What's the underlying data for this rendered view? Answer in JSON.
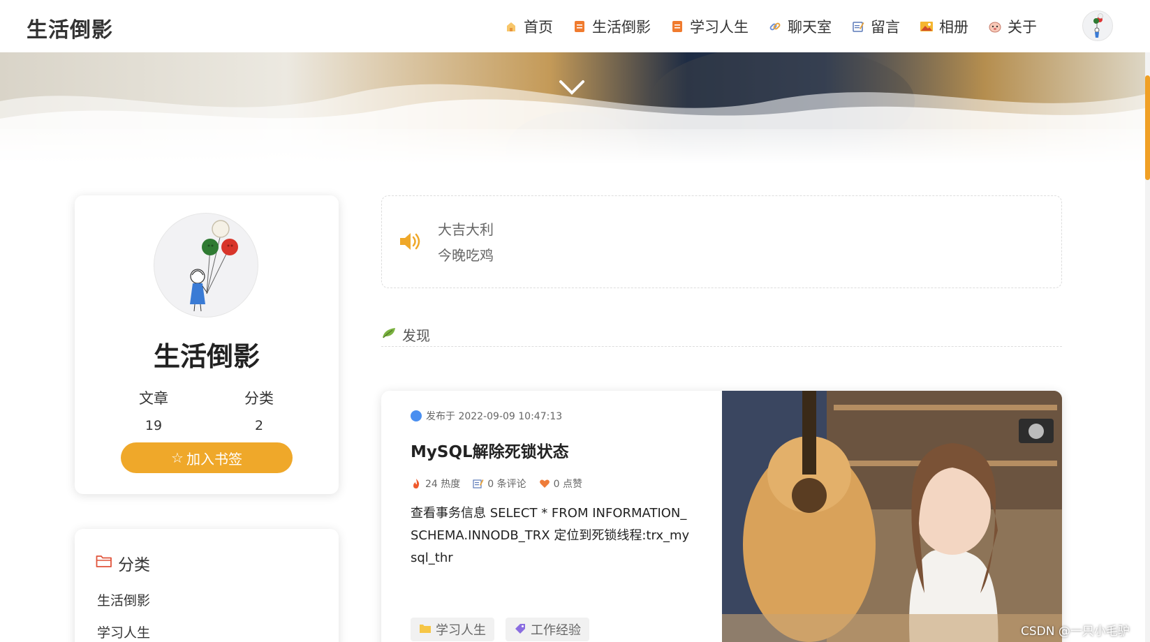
{
  "navbar": {
    "brand": "生活倒影",
    "items": [
      {
        "label": "首页",
        "icon": "home-icon",
        "color": "#f5b041"
      },
      {
        "label": "生活倒影",
        "icon": "document-icon",
        "color": "#f07b2e"
      },
      {
        "label": "学习人生",
        "icon": "document-icon",
        "color": "#f07b2e"
      },
      {
        "label": "聊天室",
        "icon": "link-icon",
        "color": "#6c8fd6"
      },
      {
        "label": "留言",
        "icon": "memo-icon",
        "color": "#5a79b8"
      },
      {
        "label": "相册",
        "icon": "picture-icon",
        "color": "#f0a020"
      },
      {
        "label": "关于",
        "icon": "face-icon",
        "color": "#e08a8a"
      }
    ]
  },
  "profile": {
    "name": "生活倒影",
    "stats": [
      {
        "label": "文章",
        "value": "19"
      },
      {
        "label": "分类",
        "value": "2"
      }
    ],
    "bookmark_label": "加入书签",
    "bookmark_color": "#efa82a"
  },
  "categories": {
    "title": "分类",
    "items": [
      "生活倒影",
      "学习人生"
    ]
  },
  "announcement": {
    "lines": [
      "大吉大利",
      "今晚吃鸡"
    ]
  },
  "section": {
    "label": "发现"
  },
  "article": {
    "date": "发布于 2022-09-09 10:47:13",
    "title": "MySQL解除死锁状态",
    "heat": "24 热度",
    "comments": "0 条评论",
    "likes": "0 点赞",
    "excerpt": "查看事务信息 SELECT * FROM INFORMATION_SCHEMA.INNODB_TRX 定位到死锁线程:trx_mysql_thr",
    "tags": [
      {
        "label": "学习人生",
        "icon": "folder-icon"
      },
      {
        "label": "工作经验",
        "icon": "tag-icon"
      }
    ]
  },
  "watermark": "CSDN @一只小毛驴"
}
